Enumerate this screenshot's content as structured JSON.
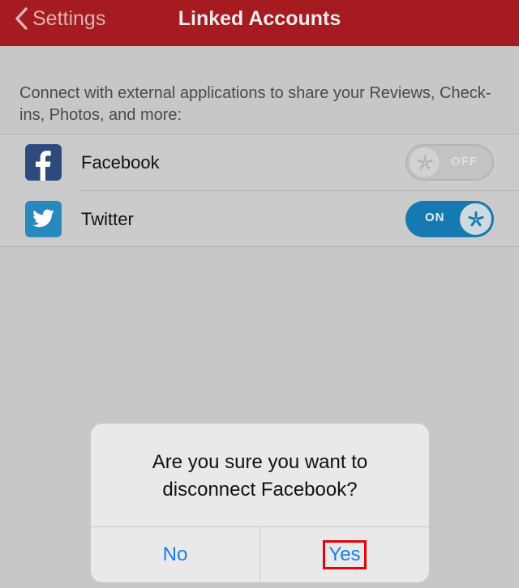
{
  "navbar": {
    "back_label": "Settings",
    "title": "Linked Accounts",
    "background": "#a51b1f"
  },
  "intro_text": "Connect with external applications to share your Reviews, Check-ins, Photos, and more:",
  "accounts": [
    {
      "name": "Facebook",
      "icon": "facebook-icon",
      "state": "OFF"
    },
    {
      "name": "Twitter",
      "icon": "twitter-icon",
      "state": "ON"
    }
  ],
  "alert": {
    "message_line1": "Are you sure you want to",
    "message_line2": "disconnect Facebook?",
    "no_label": "No",
    "yes_label": "Yes",
    "button_color": "#1b7cf0",
    "highlight_color": "#e8000c"
  }
}
